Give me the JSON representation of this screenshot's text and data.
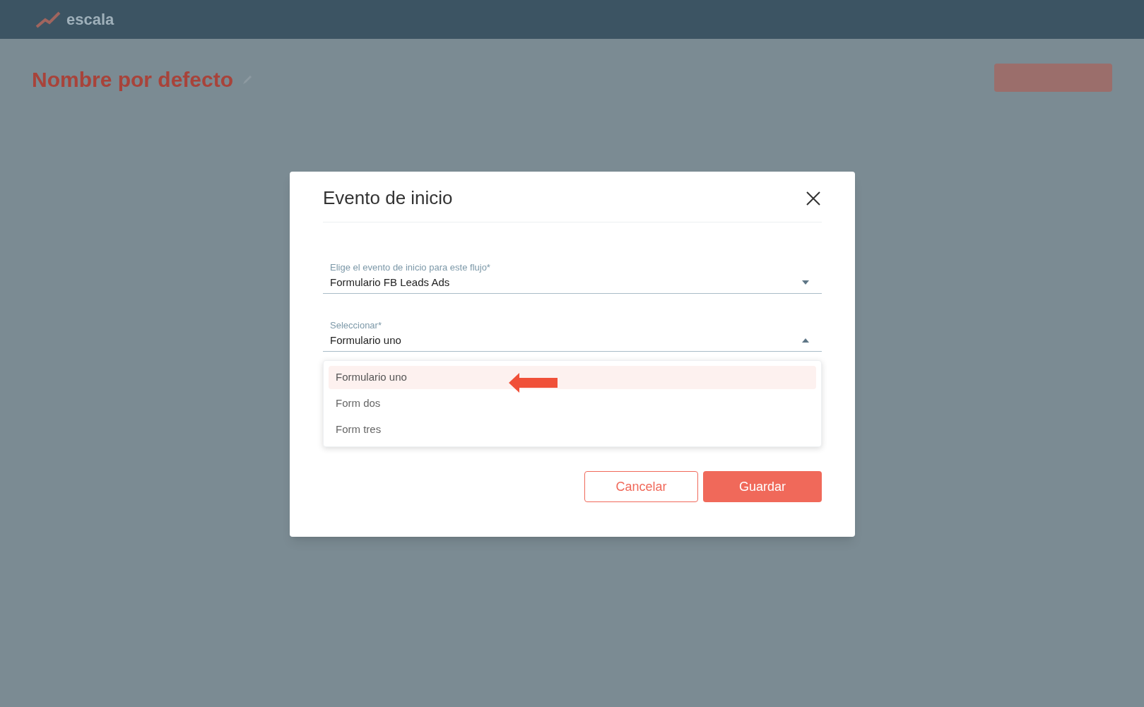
{
  "app": {
    "logo_text": "escala"
  },
  "page": {
    "title": "Nombre por defecto"
  },
  "dialog": {
    "title": "Evento de inicio",
    "fields": [
      {
        "label": "Elige el evento de inicio para este flujo*",
        "value": "Formulario FB Leads Ads",
        "expanded": false
      },
      {
        "label": "Seleccionar*",
        "value": "Formulario uno",
        "expanded": true
      }
    ],
    "options": [
      {
        "label": "Formulario uno",
        "selected": true
      },
      {
        "label": "Form dos",
        "selected": false
      },
      {
        "label": "Form tres",
        "selected": false
      }
    ],
    "buttons": [
      {
        "label": "Cancelar",
        "kind": "outline"
      },
      {
        "label": "Guardar",
        "kind": "primary"
      }
    ]
  }
}
